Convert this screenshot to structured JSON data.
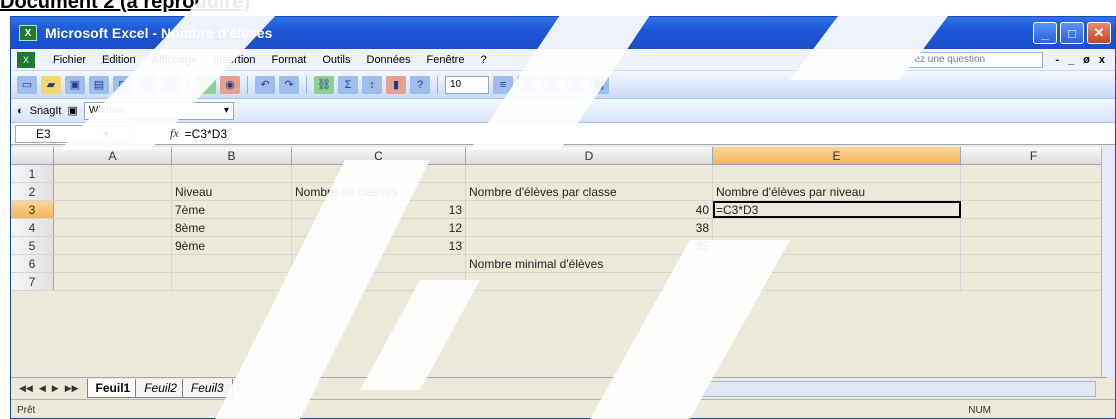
{
  "heading": "Document 2 (à reproduire)",
  "window": {
    "title": "Microsoft Excel - Nombre d'élèves",
    "app_icon": "X",
    "buttons": [
      "_",
      "□",
      "✕"
    ]
  },
  "menu": {
    "items": [
      "Fichier",
      "Edition",
      "Affichage",
      "Insertion",
      "Format",
      "Outils",
      "Données",
      "Fenêtre",
      "?"
    ],
    "help_placeholder": "Tapez une question",
    "right_controls": [
      "-",
      "_",
      "ø",
      "x"
    ]
  },
  "toolbar2": {
    "snagit_label": "SnagIt",
    "window_combo": "Window"
  },
  "font_size": "10",
  "currency_symbol": "€",
  "formula_bar": {
    "cell_ref": "E3",
    "fx": "fx",
    "formula": "=C3*D3"
  },
  "columns": [
    "A",
    "B",
    "C",
    "D",
    "E",
    "F"
  ],
  "rows": [
    {
      "num": "1",
      "cells": [
        "",
        "",
        "",
        "",
        "",
        ""
      ]
    },
    {
      "num": "2",
      "cells": [
        "",
        "Niveau",
        "Nombre de classes",
        "Nombre d'élèves par classe",
        "Nombre d'élèves par niveau",
        ""
      ]
    },
    {
      "num": "3",
      "cells": [
        "",
        "7ème",
        "13",
        "40",
        "=C3*D3",
        ""
      ]
    },
    {
      "num": "4",
      "cells": [
        "",
        "8ème",
        "12",
        "38",
        "",
        ""
      ]
    },
    {
      "num": "5",
      "cells": [
        "",
        "9ème",
        "13",
        "35",
        "",
        ""
      ]
    },
    {
      "num": "6",
      "cells": [
        "",
        "",
        "",
        "Nombre minimal d'élèves",
        "",
        ""
      ]
    },
    {
      "num": "7",
      "cells": [
        "",
        "",
        "",
        "",
        "",
        ""
      ]
    }
  ],
  "sheet_tabs": [
    "Feuil1",
    "Feuil2",
    "Feuil3"
  ],
  "status": {
    "left": "Prêt",
    "right": "NUM"
  },
  "icons": [
    "excel-app-icon",
    "minimize-icon",
    "maximize-icon",
    "close-icon",
    "new-doc-icon",
    "open-icon",
    "save-icon",
    "print-icon",
    "undo-icon",
    "redo-icon",
    "sum-icon",
    "sort-icon",
    "chart-icon",
    "align-left-icon",
    "align-center-icon",
    "align-right-icon",
    "euro-icon",
    "borders-icon"
  ]
}
